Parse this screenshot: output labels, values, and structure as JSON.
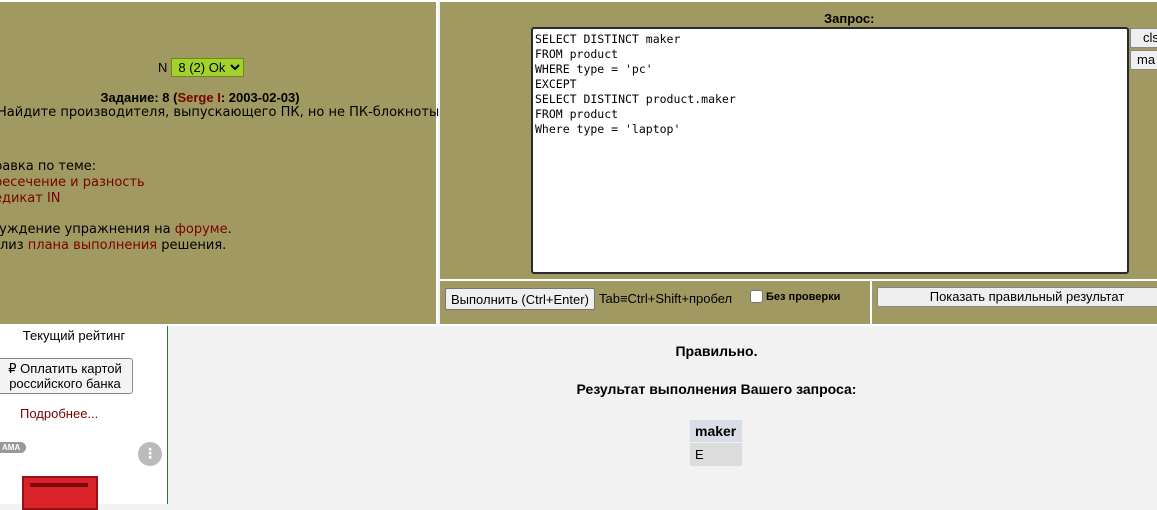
{
  "task": {
    "number_label": "N",
    "selected_option": "8 (2) Ok",
    "title_prefix": "Задание: 8 (",
    "author": "Serge I",
    "title_suffix": ": 2003-02-03)",
    "text": "Найдите производителя, выпускающего ПК, но не ПК-блокноты.",
    "help_label": "равка по теме:",
    "help_links": [
      "ресечение и разность",
      "едикат IN"
    ],
    "discuss_prefix": "суждение упражнения на ",
    "discuss_link": "форуме",
    "discuss_suffix": ".",
    "plan_prefix": "ализ ",
    "plan_link": "плана выполнения",
    "plan_suffix": " решения."
  },
  "query": {
    "label": "Запрос:",
    "text": "SELECT DISTINCT maker\nFROM product\nWHERE type = 'pc'\nEXCEPT\nSELECT DISTINCT product.maker\nFROM product\nWhere type = 'laptop'",
    "side_buttons": [
      "cls",
      "ma"
    ]
  },
  "controls": {
    "run_button": "Выполнить (Ctrl+Enter)",
    "tab_hint": "Tab≡Ctrl+Shift+пробел",
    "no_verify_label": "Без проверки",
    "show_result_button": "Показать правильный результат"
  },
  "sidebar": {
    "rating": "Текущий рейтинг",
    "pay_button": "₽ Оплатить картой российского банка",
    "more_link": "Подробнее...",
    "ad_tag": "AMA"
  },
  "result": {
    "status": "Правильно.",
    "title": "Результат выполнения Вашего запроса:",
    "columns": [
      "maker"
    ],
    "rows": [
      [
        "E"
      ]
    ]
  }
}
